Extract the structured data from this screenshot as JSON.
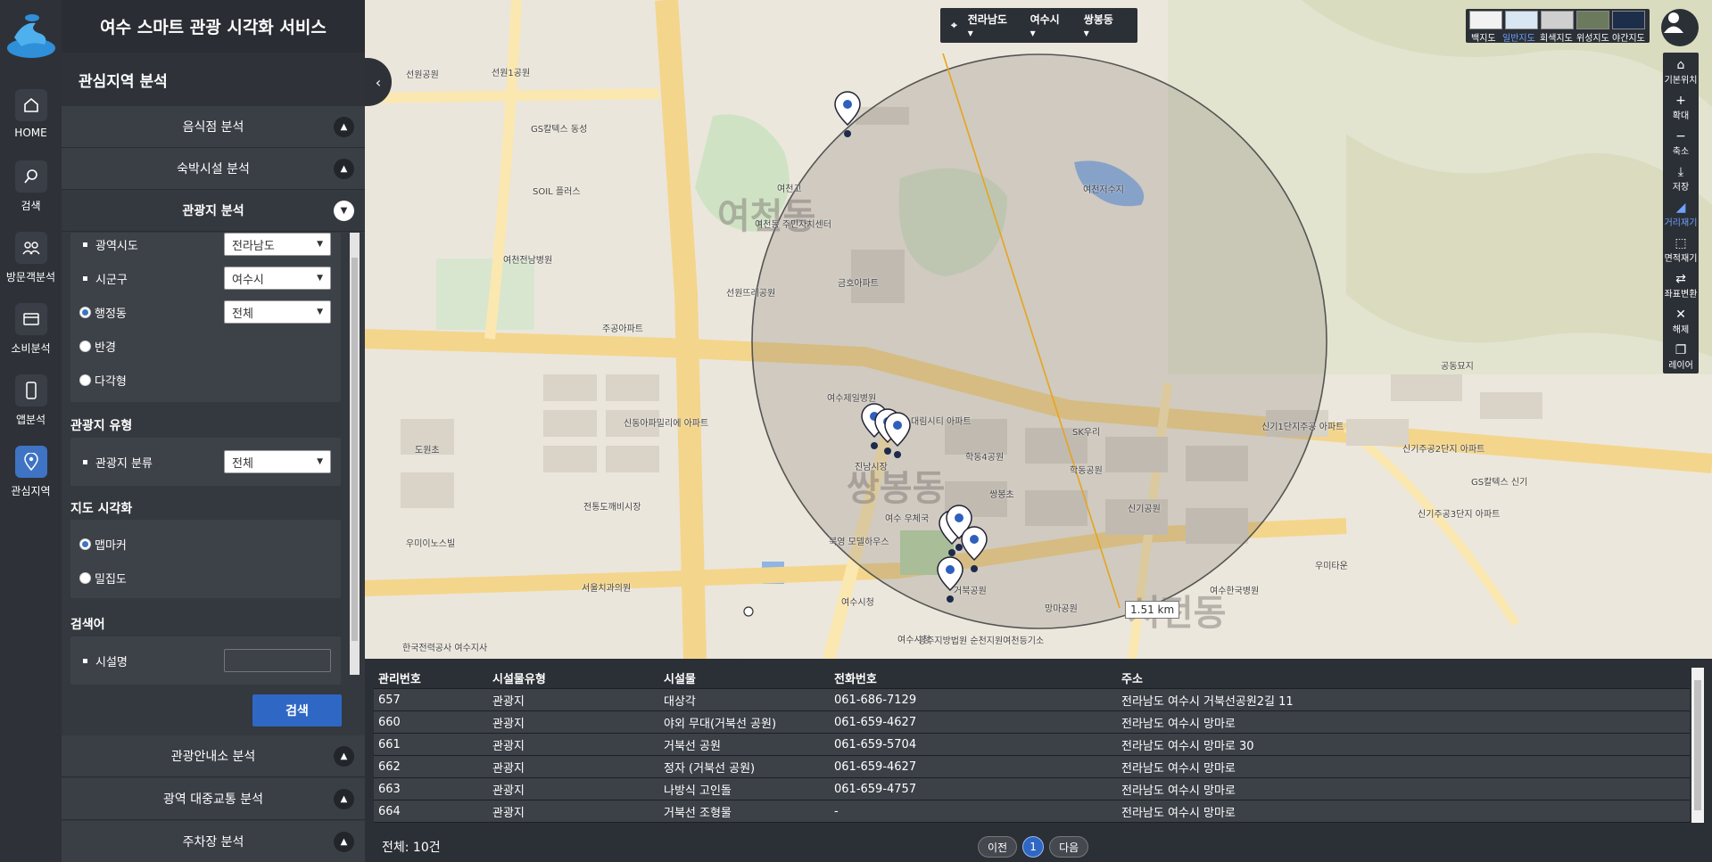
{
  "app": {
    "title": "여수 스마트 관광 시각화 서비스"
  },
  "rail": [
    {
      "label": "HOME",
      "icon": "home-icon"
    },
    {
      "label": "검색",
      "icon": "search-icon"
    },
    {
      "label": "방문객분석",
      "icon": "people-icon"
    },
    {
      "label": "소비분석",
      "icon": "card-icon"
    },
    {
      "label": "앱분석",
      "icon": "phone-icon"
    },
    {
      "label": "관심지역",
      "icon": "location-pin-icon",
      "active": true
    }
  ],
  "panel": {
    "title": "관심지역 분석",
    "accordions_top": [
      {
        "label": "음식점 분석",
        "open": false
      },
      {
        "label": "숙박시설 분석",
        "open": false
      },
      {
        "label": "관광지 분석",
        "open": true
      }
    ],
    "region": {
      "sido_label": "광역시도",
      "sido_value": "전라남도",
      "sigungu_label": "시군구",
      "sigungu_value": "여수시",
      "dong_label": "행정동",
      "dong_value": "전체",
      "radius_label": "반경",
      "polygon_label": "다각형"
    },
    "type_section": {
      "title": "관광지 유형",
      "label": "관광지 분류",
      "value": "전체"
    },
    "viz_section": {
      "title": "지도 시각화",
      "option1": "맵마커",
      "option2": "밀집도"
    },
    "keyword_section": {
      "title": "검색어",
      "label": "시설명",
      "placeholder": ""
    },
    "search_button": "검색",
    "accordions_bottom": [
      {
        "label": "관광안내소 분석"
      },
      {
        "label": "광역 대중교통 분석"
      },
      {
        "label": "주차장 분석"
      }
    ]
  },
  "map": {
    "region_bar": {
      "sido": "전라남도",
      "sigungu": "여수시",
      "dong": "쌍봉동"
    },
    "basemaps": [
      "백지도",
      "일반지도",
      "회색지도",
      "위성지도",
      "야간지도"
    ],
    "active_basemap": "일반지도",
    "tools": [
      "기본위치",
      "확대",
      "축소",
      "저장",
      "거리재기",
      "면적재기",
      "좌표변환",
      "해제",
      "레이어"
    ],
    "active_tool": "거리재기",
    "distance": "1.51 km",
    "big_labels": [
      "여천동",
      "쌍봉동",
      "시전동"
    ],
    "labels": [
      "선원공원",
      "선원1공원",
      "GS칼텍스 동성",
      "SOIL 플러스",
      "여천고",
      "여천동 주민자치센터",
      "선원뜨레공원",
      "금호아파트",
      "여천전남병원",
      "주공아파트",
      "신동아파밀리에 아파트",
      "도원초",
      "전통도깨비시장",
      "우미이노스빌",
      "서울치과의원",
      "여수제일병원",
      "진남시장",
      "여수 우체국",
      "학동4공원",
      "쌍봉초",
      "신기공원",
      "학동공원",
      "SK우리",
      "망마공원",
      "여수시청",
      "공동묘지",
      "신기1단지주공 아파트",
      "신기주공2단지 아파트",
      "GS칼텍스 신기",
      "신기주공3단지 아파트",
      "우미타운",
      "여수한국병원",
      "여천저수지",
      "거북공원",
      "광주지방법원 순천지원여천등기소",
      "한국전력공사 여수지사",
      "대림시티 아파트",
      "북영 모델하우스",
      "여수시청"
    ]
  },
  "table": {
    "columns": [
      "관리번호",
      "시설물유형",
      "시설물",
      "전화번호",
      "주소"
    ],
    "rows": [
      [
        "657",
        "관광지",
        "대상각",
        "061-686-7129",
        "전라남도 여수시 거북선공원2길 11"
      ],
      [
        "660",
        "관광지",
        "야외 무대(거북선 공원)",
        "061-659-4627",
        "전라남도 여수시 망마로"
      ],
      [
        "661",
        "관광지",
        "거북선 공원",
        "061-659-5704",
        "전라남도 여수시 망마로 30"
      ],
      [
        "662",
        "관광지",
        "정자 (거북선 공원)",
        "061-659-4627",
        "전라남도 여수시 망마로"
      ],
      [
        "663",
        "관광지",
        "나방식 고인돌",
        "061-659-4757",
        "전라남도 여수시 망마로"
      ],
      [
        "664",
        "관광지",
        "거북선 조형물",
        "-",
        "전라남도 여수시 망마로"
      ]
    ],
    "total": "전체: 10건",
    "prev": "이전",
    "page": "1",
    "next": "다음"
  },
  "colors": {
    "accent": "#2f67c4",
    "panel": "#34383f",
    "rail": "#2e3238"
  }
}
